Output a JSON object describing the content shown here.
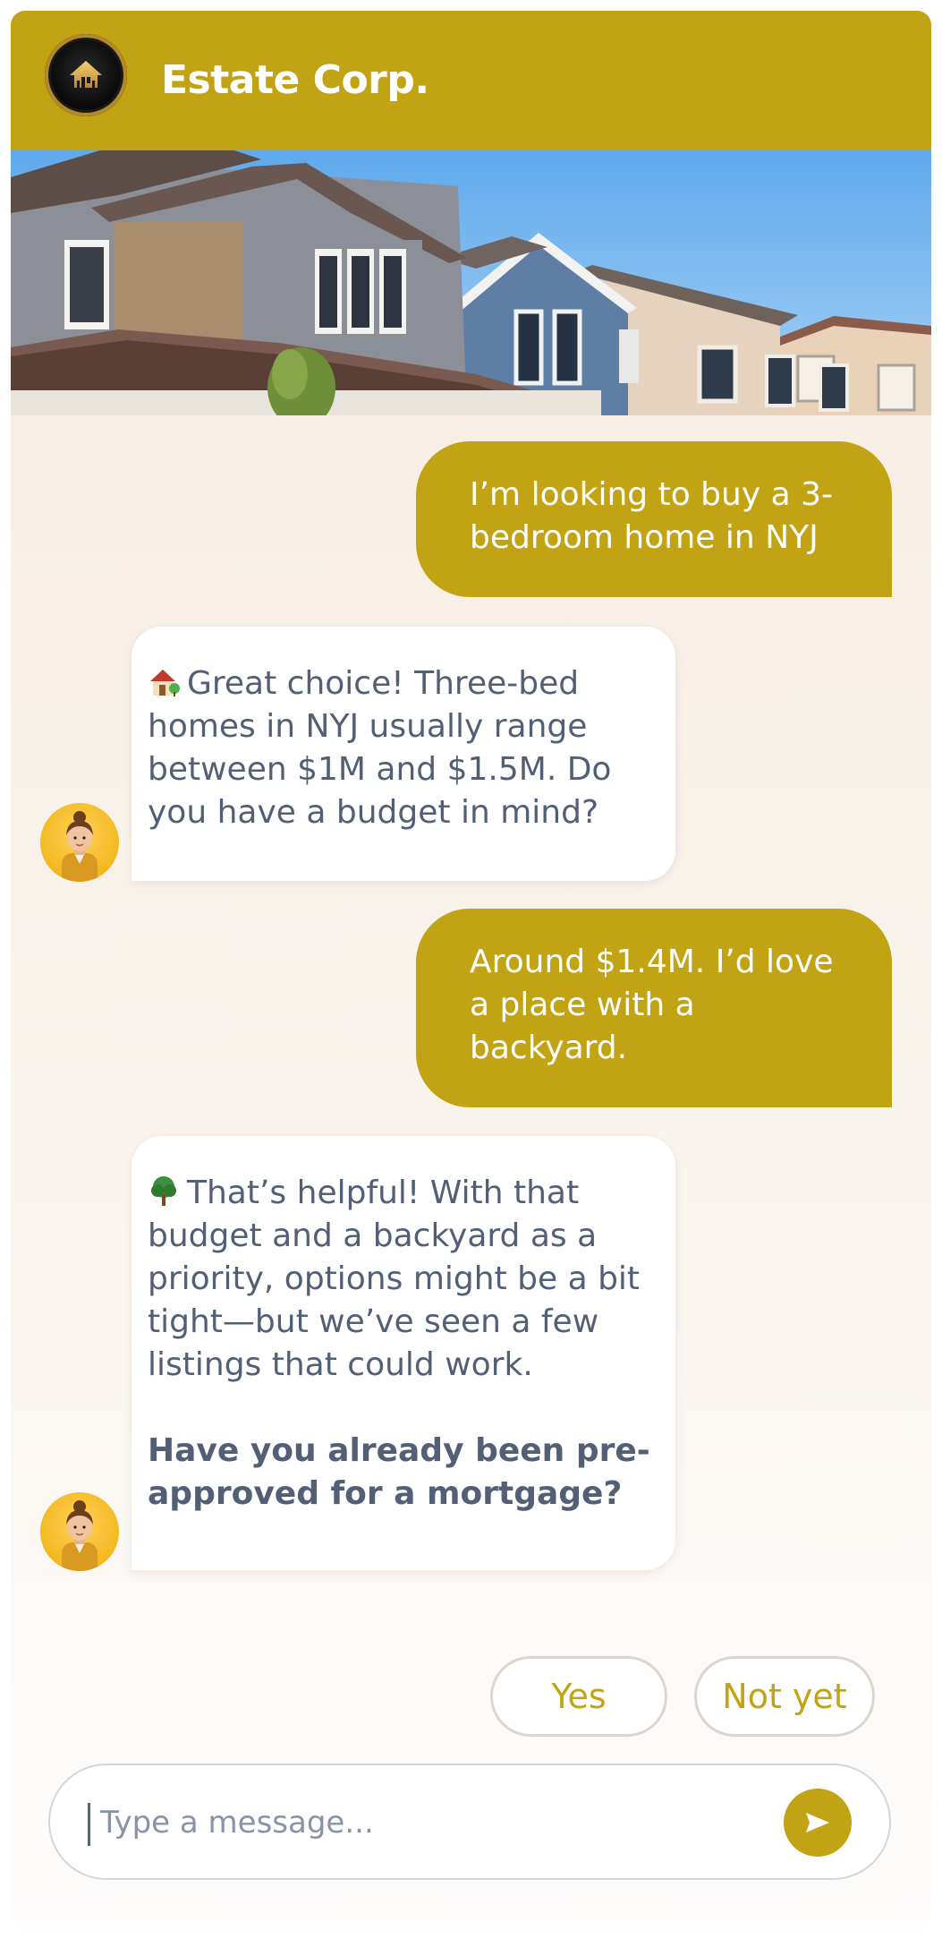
{
  "brand": {
    "name": "Estate Corp."
  },
  "messages": [
    {
      "role": "user",
      "text": "I’m looking to buy a 3-bedroom home in NYJ"
    },
    {
      "role": "bot",
      "emoji": "house-with-garden",
      "text": "Great choice! Three-bed homes in NYJ usually range between $1M and $1.5M. Do you have a budget in mind?"
    },
    {
      "role": "user",
      "text": "Around $1.4M. I’d love a place with a backyard."
    },
    {
      "role": "bot",
      "emoji": "tree",
      "text": "That’s helpful! With that budget and a backyard as a priority, options might be a bit tight—but we’ve seen a few listings that could work.",
      "question": "Have you already been pre-approved for a mortgage?"
    }
  ],
  "quick_replies": [
    "Yes",
    "Not yet"
  ],
  "composer": {
    "placeholder": "Type a message..."
  },
  "colors": {
    "accent": "#c2a313",
    "bot_text": "#535f75",
    "background": "#f5ebe0"
  },
  "icons": {
    "send": "send-icon",
    "logo": "house-logo-icon",
    "avatar": "agent-avatar"
  }
}
